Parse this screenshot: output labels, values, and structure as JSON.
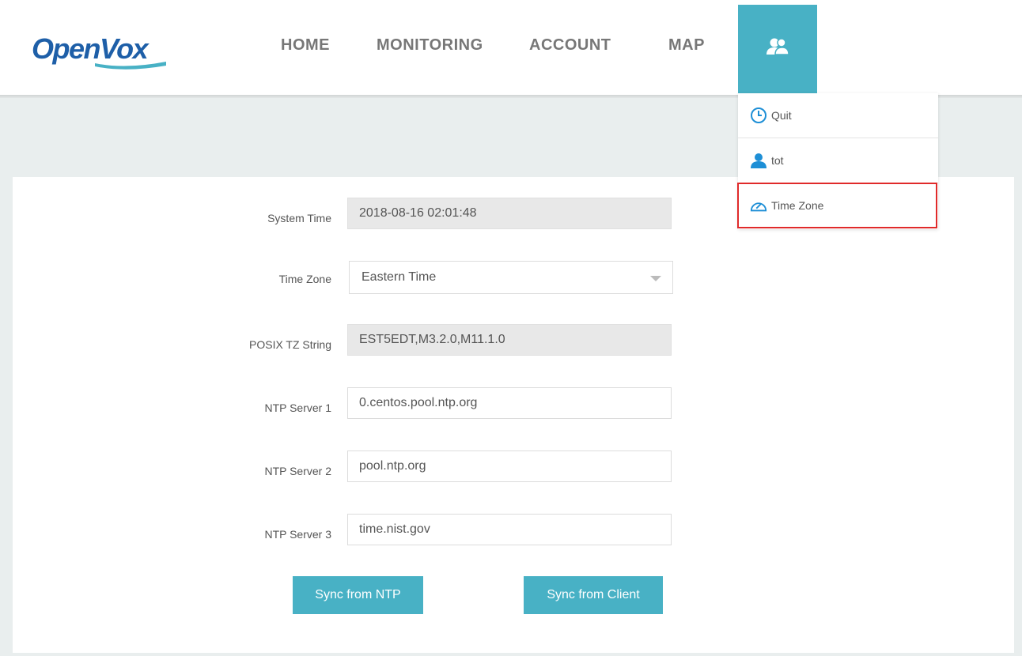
{
  "brand": {
    "logo_text": "OpenVox"
  },
  "nav": {
    "items": [
      {
        "label": "HOME"
      },
      {
        "label": "MONITORING"
      },
      {
        "label": "ACCOUNT"
      },
      {
        "label": "MAP"
      }
    ],
    "user_icon": "users-icon"
  },
  "user_menu": {
    "items": [
      {
        "label": "Quit",
        "icon": "clock-icon"
      },
      {
        "label": "tot",
        "icon": "user-icon"
      },
      {
        "label": "Time Zone",
        "icon": "gauge-icon"
      }
    ],
    "highlighted_item": "Time Zone"
  },
  "form": {
    "system_time": {
      "label": "System Time",
      "value": "2018-08-16 02:01:48"
    },
    "time_zone": {
      "label": "Time Zone",
      "value": "Eastern Time"
    },
    "posix_tz": {
      "label": "POSIX TZ String",
      "value": "EST5EDT,M3.2.0,M11.1.0"
    },
    "ntp1": {
      "label": "NTP Server 1",
      "value": "0.centos.pool.ntp.org"
    },
    "ntp2": {
      "label": "NTP Server 2",
      "value": "pool.ntp.org"
    },
    "ntp3": {
      "label": "NTP Server 3",
      "value": "time.nist.gov"
    }
  },
  "buttons": {
    "sync_ntp": "Sync from NTP",
    "sync_client": "Sync from Client"
  },
  "colors": {
    "accent": "#48b1c5",
    "logo_blue": "#1e5fa8",
    "highlight_border": "#e02a2a",
    "banner_bg": "#e9eeee"
  }
}
